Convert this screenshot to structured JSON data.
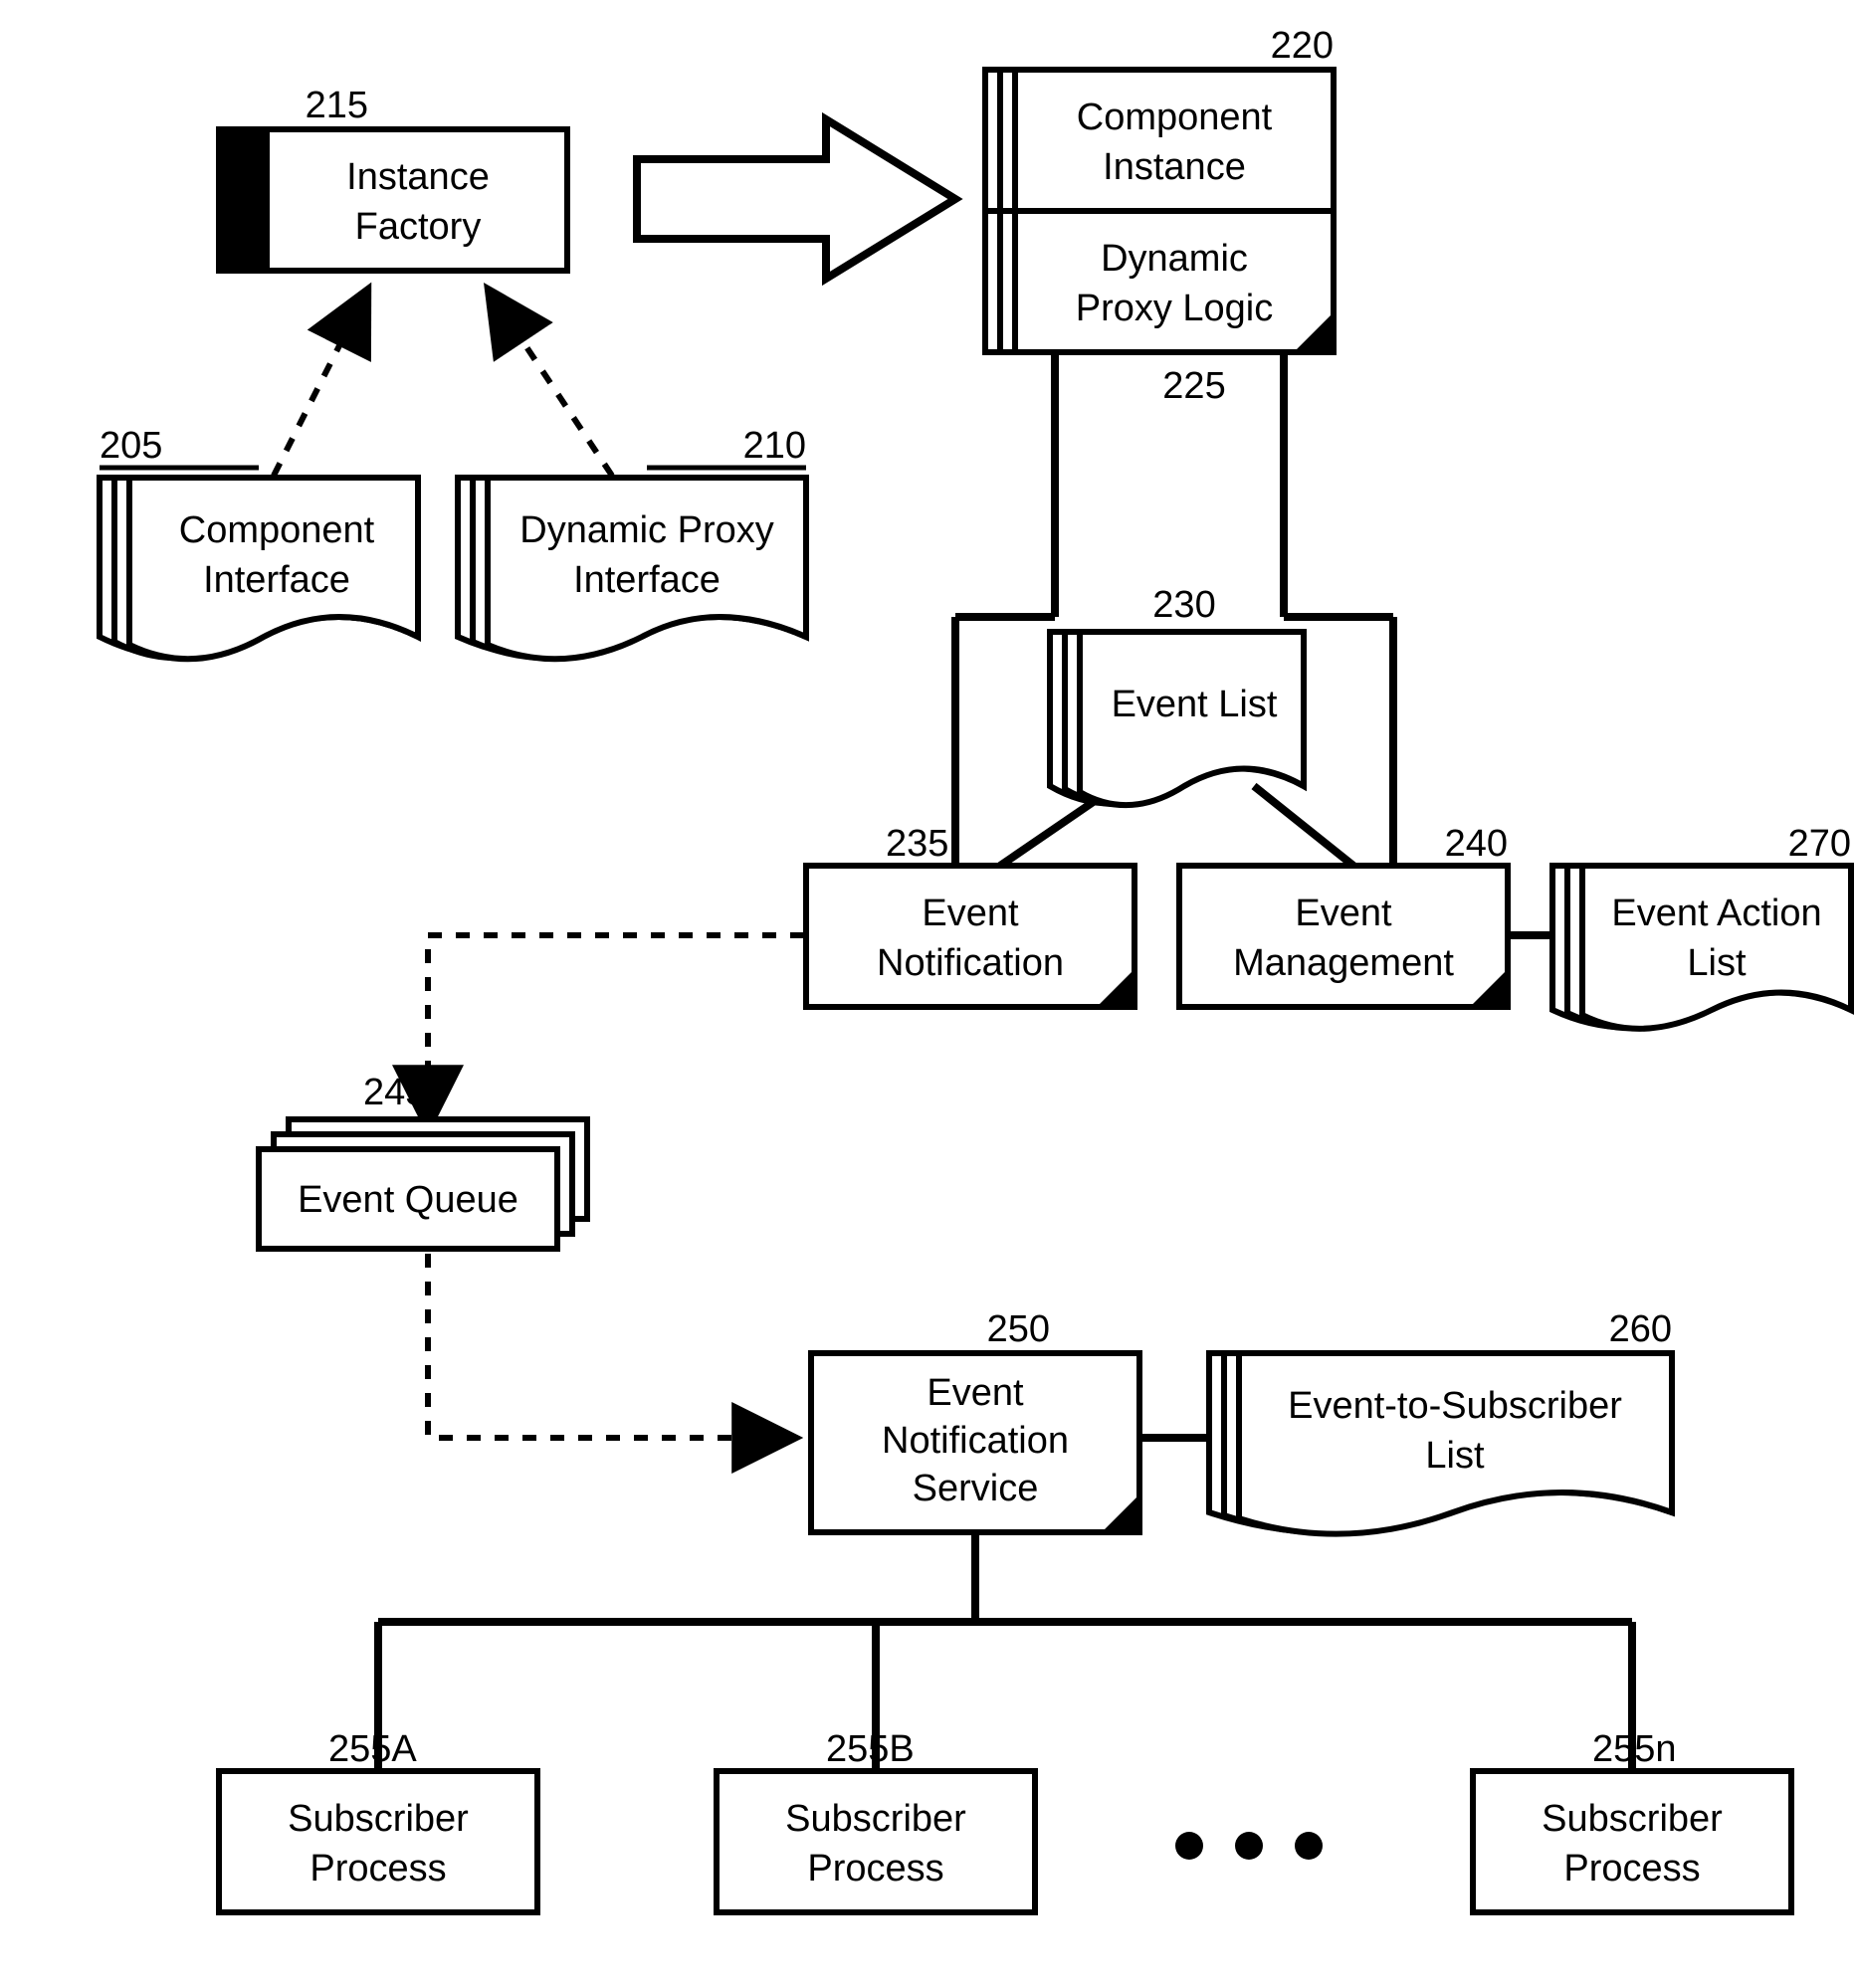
{
  "nodes": {
    "instanceFactory": {
      "id": "215",
      "label_l1": "Instance",
      "label_l2": "Factory"
    },
    "componentInterface": {
      "id": "205",
      "label_l1": "Component",
      "label_l2": "Interface"
    },
    "dynamicProxyIface": {
      "id": "210",
      "label_l1": "Dynamic Proxy",
      "label_l2": "Interface"
    },
    "componentInstance": {
      "id": "220",
      "label_l1": "Component",
      "label_l2": "Instance"
    },
    "dynamicProxyLogic": {
      "id": "225",
      "label_l1": "Dynamic",
      "label_l2": "Proxy Logic"
    },
    "eventList": {
      "id": "230",
      "label_l1": "Event List",
      "label_l2": ""
    },
    "eventNotification": {
      "id": "235",
      "label_l1": "Event",
      "label_l2": "Notification"
    },
    "eventManagement": {
      "id": "240",
      "label_l1": "Event",
      "label_l2": "Management"
    },
    "eventActionList": {
      "id": "270",
      "label_l1": "Event Action",
      "label_l2": "List"
    },
    "eventQueue": {
      "id": "245",
      "label_l1": "Event Queue",
      "label_l2": ""
    },
    "eventNotifService": {
      "id": "250",
      "label_l1": "Event",
      "label_l2": "Notification",
      "label_l3": "Service"
    },
    "eventToSubList": {
      "id": "260",
      "label_l1": "Event-to-Subscriber",
      "label_l2": "List"
    },
    "subA": {
      "id": "255A",
      "label_l1": "Subscriber",
      "label_l2": "Process"
    },
    "subB": {
      "id": "255B",
      "label_l1": "Subscriber",
      "label_l2": "Process"
    },
    "subN": {
      "id": "255n",
      "label_l1": "Subscriber",
      "label_l2": "Process"
    }
  }
}
